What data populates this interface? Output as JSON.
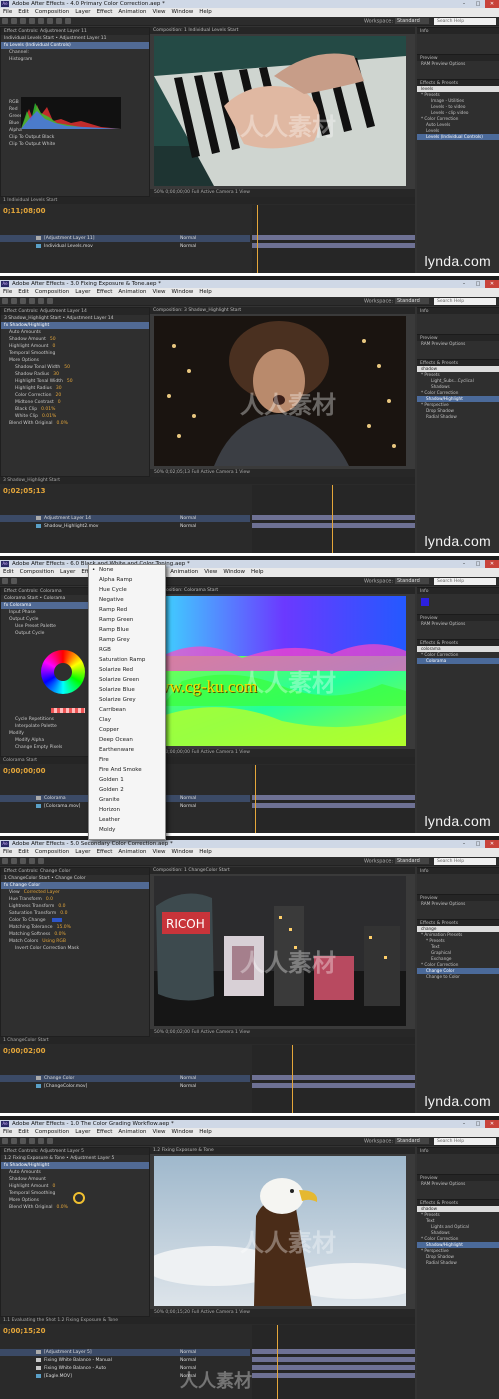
{
  "shots": [
    {
      "title": "Adobe After Effects - 4.0 Primary Color Correction.aep *",
      "menus": [
        "File",
        "Edit",
        "Composition",
        "Layer",
        "Effect",
        "Animation",
        "View",
        "Window",
        "Help"
      ],
      "workspace_label": "Workspace:",
      "workspace": "Standard",
      "search": "Search Help",
      "effect_panel_tab": "Effect Controls: Adjustment Layer 11",
      "effect_controls": [
        "Individual Levels Start • Adjustment Layer 11",
        "fx Levels (Individual Controls)",
        "Channel:",
        "Histogram",
        "RGB",
        "Red",
        "Green",
        "Blue",
        "Alpha",
        "Clip To Output Black",
        "Clip To Output White"
      ],
      "comp_tab": "Composition: 1 Individual Levels Start",
      "viewer_footer": "50%   0;00;00;00   Full   Active Camera   1 View",
      "timeline_tabs": "1 Individual Levels Start",
      "timecode": "0;11;08;00",
      "layers": [
        "[Adjustment Layer 11]",
        "Individual Levels.mov"
      ],
      "layer_modes": [
        "Normal",
        "Normal"
      ],
      "right_panels": [
        "Info",
        "Audio",
        "Preview",
        "RAM Preview Options",
        "Effects & Presets",
        "Character"
      ],
      "right_items": [
        "levels",
        "* Presets",
        "Image - Utilities",
        "Levels - to video",
        "Levels - clip video",
        "* Color Correction",
        "Auto Levels",
        "Levels",
        "Levels (Individual Controls)"
      ],
      "brand": "lynda.com"
    },
    {
      "title": "Adobe After Effects - 3.0 Fixing Exposure & Tone.aep *",
      "menus": [
        "File",
        "Edit",
        "Composition",
        "Layer",
        "Effect",
        "Animation",
        "View",
        "Window",
        "Help"
      ],
      "workspace_label": "Workspace:",
      "workspace": "Standard",
      "search": "Search Help",
      "effect_panel_tab": "Effect Controls: Adjustment Layer 14",
      "effect_controls": [
        "3 Shadow_Highlight Start • Adjustment Layer 14",
        "fx Shadow/Highlight",
        "Auto Amounts",
        "Shadow Amount",
        "Highlight Amount",
        "Temporal Smoothing",
        "More Options",
        "Shadow Tonal Width",
        "Shadow Radius",
        "Highlight Tonal Width",
        "Highlight Radius",
        "Color Correction",
        "Midtone Contrast",
        "Black Clip",
        "White Clip",
        "Blend With Original"
      ],
      "effect_values": [
        "",
        "",
        "",
        "50",
        "0",
        "",
        "",
        "50",
        "30",
        "50",
        "30",
        "20",
        "0",
        "0.01%",
        "0.01%",
        "0.0%"
      ],
      "comp_tab": "Composition: 3 Shadow_Highlight Start",
      "viewer_footer": "50%   0;02;05;13   Full   Active Camera   1 View",
      "timeline_tabs": "3 Shadow_Highlight Start",
      "timecode": "0;02;05;13",
      "layers": [
        "Adjustment Layer 14",
        "Shadow_Highlight2.mov"
      ],
      "layer_modes": [
        "Normal",
        "Normal"
      ],
      "right_panels": [
        "Info",
        "Audio",
        "Preview",
        "RAM Preview Options",
        "Effects & Presets",
        "Character"
      ],
      "right_items": [
        "shadow",
        "* Presets",
        "Light_Subs...Cyclical",
        "Shadows",
        "* Color Correction",
        "Shadow/Highlight",
        "* Perspective",
        "Drop Shadow",
        "Radial Shadow"
      ],
      "brand": "lynda.com"
    },
    {
      "title": "Adobe After Effects - 6.0 Black and White and Color Toning.aep *",
      "menus": [
        "Edit",
        "Composition",
        "Layer",
        "Effect",
        "Animation",
        "View",
        "Window",
        "Help"
      ],
      "workspace_label": "Workspace:",
      "workspace": "Standard",
      "search": "Search Help",
      "effect_panel_tab": "Effect Controls: Colorama",
      "effect_controls": [
        "Colorama Start • Colorama",
        "fx Colorama",
        "Input Phase",
        "Output Cycle",
        "Use Preset Palette",
        "Output Cycle",
        "Cycle Repetitions",
        "Interpolate Palette",
        "Modify",
        "Modify Alpha",
        "Change Empty Pixels"
      ],
      "dropdown": [
        "None",
        "Alpha Ramp",
        "Hue Cycle",
        "Negative",
        "Ramp Red",
        "Ramp Green",
        "Ramp Blue",
        "Ramp Grey",
        "RGB",
        "Saturation Ramp",
        "Solarize Red",
        "Solarize Green",
        "Solarize Blue",
        "Solarize Grey",
        "Carribean",
        "Clay",
        "Copper",
        "Deep Ocean",
        "Earthenware",
        "Fire",
        "Fire And Smoke",
        "Golden 1",
        "Golden 2",
        "Granite",
        "Horizon",
        "Leather",
        "Moldy"
      ],
      "comp_tab": "Composition: Colorama Start",
      "viewer_footer": "50%   0;00;00;00   Full   Active Camera   1 View",
      "timeline_tabs": "Colorama Start",
      "timecode": "0;00;00;00",
      "layers": [
        "Colorama",
        "[Colorama.mov]"
      ],
      "layer_modes": [
        "Normal",
        "Normal"
      ],
      "right_panels": [
        "Info",
        "Audio",
        "Preview",
        "RAM Preview Options",
        "Effects & Presets",
        "Character"
      ],
      "right_items": [
        "colorama",
        "* Color Correction",
        "Colorama"
      ],
      "watermark_url": "www.cg-ku.com",
      "brand": "lynda.com"
    },
    {
      "title": "Adobe After Effects - 5.0 Secondary Color Correction.aep *",
      "menus": [
        "File",
        "Edit",
        "Composition",
        "Layer",
        "Effect",
        "Animation",
        "View",
        "Window",
        "Help"
      ],
      "workspace_label": "Workspace:",
      "workspace": "Standard",
      "search": "Search Help",
      "effect_panel_tab": "Effect Controls: Change Color",
      "effect_controls": [
        "1 ChangeColor Start • Change Color",
        "fx Change Color",
        "View",
        "Hue Transform",
        "Lightness Transform",
        "Saturation Transform",
        "Color To Change",
        "Matching Tolerance",
        "Matching Softness",
        "Match Colors",
        "Invert Color Correction Mask"
      ],
      "effect_values": [
        "",
        "",
        "Corrected Layer",
        "0.0",
        "0.0",
        "0.0",
        "",
        "15.0%",
        "0.0%",
        "Using RGB",
        ""
      ],
      "comp_tab": "Composition: 1 ChangeColor Start",
      "viewer_footer": "50%   0;00;02;00   Full   Active Camera   1 View",
      "timeline_tabs": "1 ChangeColor Start",
      "timecode": "0;00;02;00",
      "layers": [
        "Change Color",
        "[ChangeColor.mov]"
      ],
      "layer_modes": [
        "Normal",
        "Normal"
      ],
      "right_panels": [
        "Info",
        "Audio",
        "Preview",
        "RAM Preview Options",
        "Effects & Presets",
        "Character"
      ],
      "right_items": [
        "change",
        "* Animation Presets",
        "* Presets",
        "Text",
        "Graphical",
        "Exchange",
        "* Color Correction",
        "Change Color",
        "Change to Color"
      ],
      "brand": "lynda.com"
    },
    {
      "title": "Adobe After Effects - 1.0 The Color Grading Workflow.aep *",
      "menus": [
        "File",
        "Edit",
        "Composition",
        "Layer",
        "Effect",
        "Animation",
        "View",
        "Window",
        "Help"
      ],
      "workspace_label": "Workspace:",
      "workspace": "Standard",
      "search": "Search Help",
      "effect_panel_tab": "Effect Controls: Adjustment Layer 5",
      "effect_controls": [
        "1.2 Fixing Exposure & Tone • Adjustment Layer 5",
        "fx Shadow/Highlight",
        "Auto Amounts",
        "Shadow Amount",
        "Highlight Amount",
        "Temporal Smoothing",
        "More Options",
        "Blend With Original"
      ],
      "effect_values": [
        "",
        "",
        "",
        "",
        "0",
        "",
        "",
        "0.0%"
      ],
      "comp_tab": "1.2 Fixing Exposure & Tone",
      "viewer_footer": "50%   0;00;15;20   Full   Active Camera   1 View",
      "timeline_tabs": "1.1 Evaluating the Shot   1.2 Fixing Exposure & Tone",
      "timecode": "0;00;15;20",
      "layers": [
        "[Adjustment Layer 5]",
        "Fixing White Balance - Manual",
        "Fixing White Balance - Auto",
        "[Eagle.MOV]"
      ],
      "layer_modes": [
        "Normal",
        "Normal",
        "Normal",
        "Normal"
      ],
      "right_panels": [
        "Info",
        "Audio",
        "Preview",
        "RAM Preview Options",
        "Effects & Presets",
        "Character"
      ],
      "right_items": [
        "shadow",
        "* Presets",
        "Text",
        "Lights and Optical",
        "Shadows",
        "* Color Correction",
        "Shadow/Highlight",
        "* Perspective",
        "Drop Shadow",
        "Radial Shadow"
      ],
      "brand": "lynda.com"
    }
  ],
  "colors": {
    "accent": "#e4a63a",
    "selection": "#516a94",
    "track": "#7b7fa8"
  }
}
